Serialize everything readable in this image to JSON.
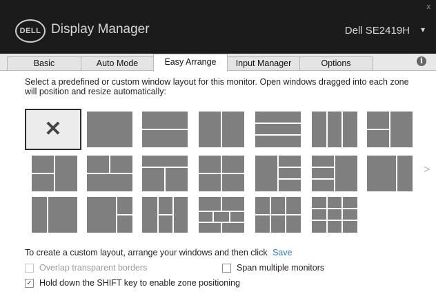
{
  "titlebar": {
    "logo_text": "DELL",
    "app_title": "Display Manager",
    "monitor": "Dell SE2419H",
    "close_glyph": "x",
    "chevron_glyph": "▾"
  },
  "tabs": [
    {
      "label": "Basic",
      "active": false
    },
    {
      "label": "Auto Mode",
      "active": false
    },
    {
      "label": "Easy Arrange",
      "active": true
    },
    {
      "label": "Input Manager",
      "active": false
    },
    {
      "label": "Options",
      "active": false
    }
  ],
  "info_glyph": "i",
  "instructions": "Select a predefined or custom window layout for this monitor.  Open windows dragged into each zone will position and resize automatically:",
  "layouts": {
    "selected_glyph": "✕",
    "next_glyph": ">"
  },
  "custom_prompt": "To create a custom layout, arrange your windows and then click",
  "save_label": "Save",
  "options": {
    "overlap": {
      "label": "Overlap transparent borders",
      "checked": false,
      "enabled": false
    },
    "span": {
      "label": "Span multiple monitors",
      "checked": false,
      "enabled": true
    },
    "shift": {
      "label": "Hold down the SHIFT key to enable zone positioning",
      "checked": true,
      "enabled": true
    }
  },
  "colors": {
    "accent_link": "#2a7ad5",
    "titlebar": "#1b1b1b",
    "zone": "#7f7f7f"
  }
}
